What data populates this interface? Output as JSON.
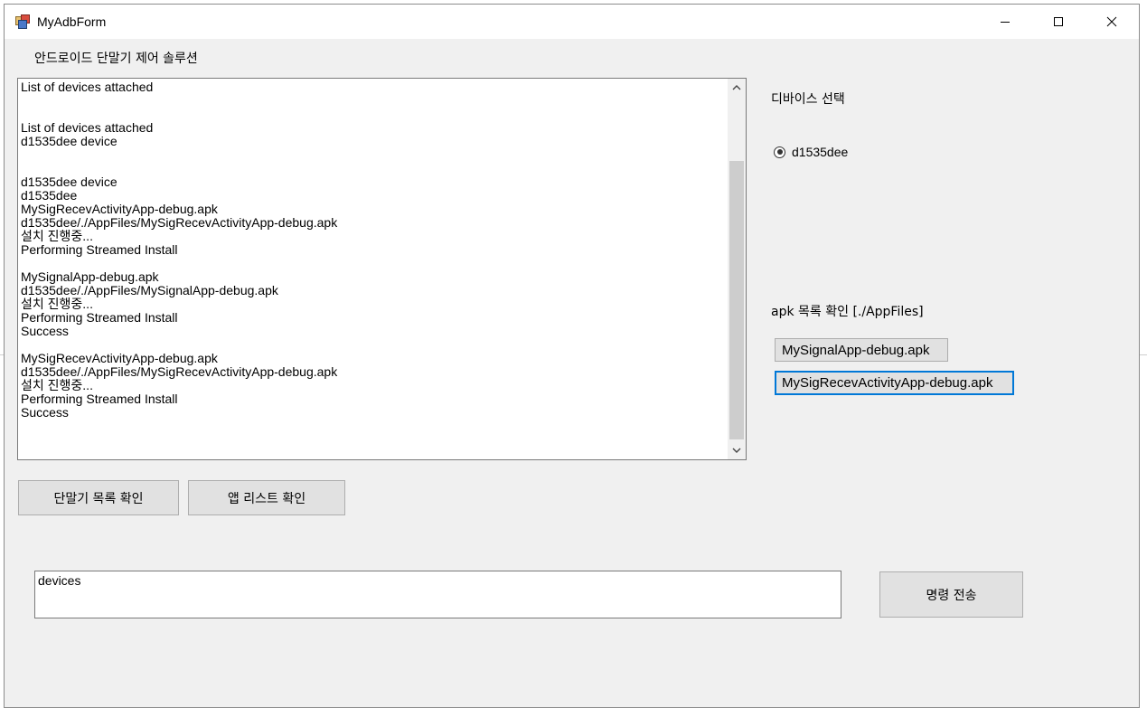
{
  "window": {
    "title": "MyAdbForm",
    "minimize_icon": "minimize-icon",
    "maximize_icon": "maximize-icon",
    "close_icon": "close-icon"
  },
  "header_label": "안드로이드 단말기 제어 솔루션",
  "log": {
    "lines": [
      "List of devices attached",
      "",
      "",
      "List of devices attached",
      "d1535dee device",
      "",
      "",
      "d1535dee device",
      "d1535dee",
      "MySigRecevActivityApp-debug.apk",
      "d1535dee/./AppFiles/MySigRecevActivityApp-debug.apk",
      "설치 진행중...",
      "Performing Streamed Install",
      "",
      "MySignalApp-debug.apk",
      "d1535dee/./AppFiles/MySignalApp-debug.apk",
      "설치 진행중...",
      "Performing Streamed Install",
      "Success",
      "",
      "MySigRecevActivityApp-debug.apk",
      "d1535dee/./AppFiles/MySigRecevActivityApp-debug.apk",
      "설치 진행중...",
      "Performing Streamed Install",
      "Success"
    ]
  },
  "device_section": {
    "label": "디바이스 선택",
    "devices": [
      {
        "id": "d1535dee",
        "selected": true
      }
    ]
  },
  "apk_section": {
    "label": "apk 목록 확인 [./AppFiles]",
    "files": [
      {
        "name": "MySignalApp-debug.apk",
        "focused": false
      },
      {
        "name": "MySigRecevActivityApp-debug.apk",
        "focused": true
      }
    ]
  },
  "buttons": {
    "device_list": "단말기 목록 확인",
    "app_list": "앱 리스트 확인",
    "send_command": "명령 전송"
  },
  "command_input": {
    "value": "devices"
  },
  "colors": {
    "window_bg": "#f0f0f0",
    "button_bg": "#e1e1e1",
    "focus_border": "#0078d7"
  }
}
